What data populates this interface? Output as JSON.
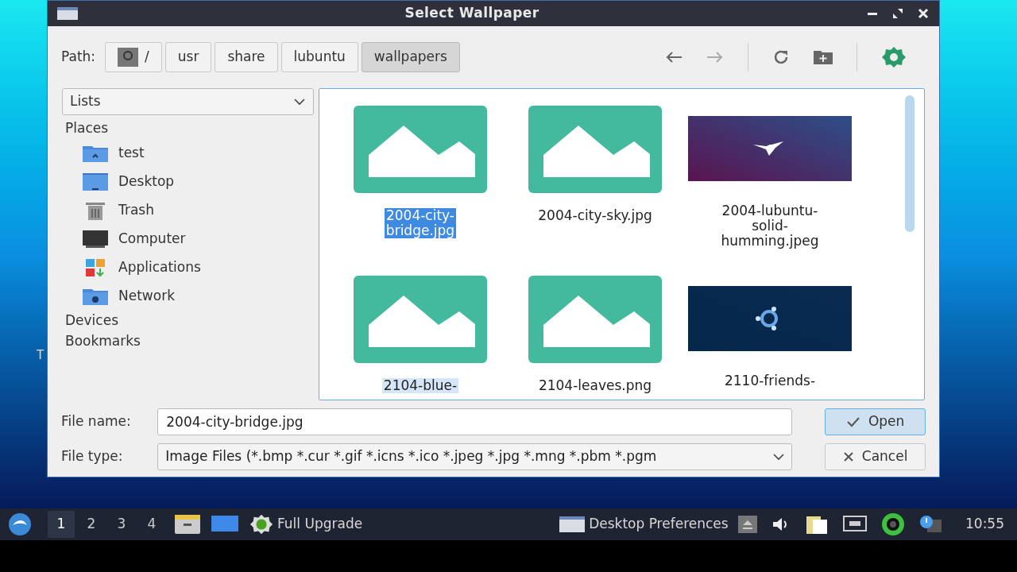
{
  "desktop_text": "T",
  "window": {
    "title": "Select Wallpaper"
  },
  "path": {
    "label": "Path:",
    "segments": [
      {
        "label": "/",
        "kind": "root",
        "selected": false
      },
      {
        "label": "usr",
        "kind": "dir",
        "selected": false
      },
      {
        "label": "share",
        "kind": "dir",
        "selected": false
      },
      {
        "label": "lubuntu",
        "kind": "dir",
        "selected": false
      },
      {
        "label": "wallpapers",
        "kind": "dir",
        "selected": true
      }
    ]
  },
  "sidebar": {
    "view": "Lists",
    "sections": [
      {
        "label": "Places",
        "items": [
          {
            "label": "test",
            "kind": "home"
          },
          {
            "label": "Desktop",
            "kind": "desktop"
          },
          {
            "label": "Trash",
            "kind": "trash"
          },
          {
            "label": "Computer",
            "kind": "computer"
          },
          {
            "label": "Applications",
            "kind": "apps"
          },
          {
            "label": "Network",
            "kind": "network"
          }
        ]
      },
      {
        "label": "Devices"
      },
      {
        "label": "Bookmarks"
      }
    ]
  },
  "files": [
    {
      "name": "2004-city-bridge.jpg",
      "kind": "placeholder",
      "selected": true,
      "hovered": false
    },
    {
      "name": "2004-city-sky.jpg",
      "kind": "placeholder",
      "selected": false,
      "hovered": false
    },
    {
      "name": "2004-lubuntu-solid-humming.jpeg",
      "kind": "picture",
      "selected": false,
      "hovered": false
    },
    {
      "name": "2104-blue-",
      "kind": "placeholder",
      "selected": false,
      "hovered": true
    },
    {
      "name": "2104-leaves.png",
      "kind": "placeholder",
      "selected": false,
      "hovered": false
    },
    {
      "name": "2110-friends-",
      "kind": "picture",
      "selected": false,
      "hovered": false
    }
  ],
  "file_name": {
    "label": "File name:",
    "value": "2004-city-bridge.jpg"
  },
  "file_type": {
    "label": "File type:",
    "value": "Image Files (*.bmp *.cur *.gif *.icns *.ico *.jpeg *.jpg *.mng *.pbm *.pgm"
  },
  "buttons": [
    {
      "label": "Open",
      "kind": "open"
    },
    {
      "label": "Cancel",
      "kind": "cancel"
    }
  ],
  "taskbar": {
    "workspaces": [
      {
        "label": "1",
        "selected": true
      },
      {
        "label": "2",
        "selected": false
      },
      {
        "label": "3",
        "selected": false
      },
      {
        "label": "4",
        "selected": false
      }
    ],
    "tasks": [
      {
        "label": "Full Upgrade",
        "kind": "gear"
      },
      {
        "label": "Desktop Preferences",
        "kind": "window"
      }
    ],
    "clock": "10:55"
  }
}
